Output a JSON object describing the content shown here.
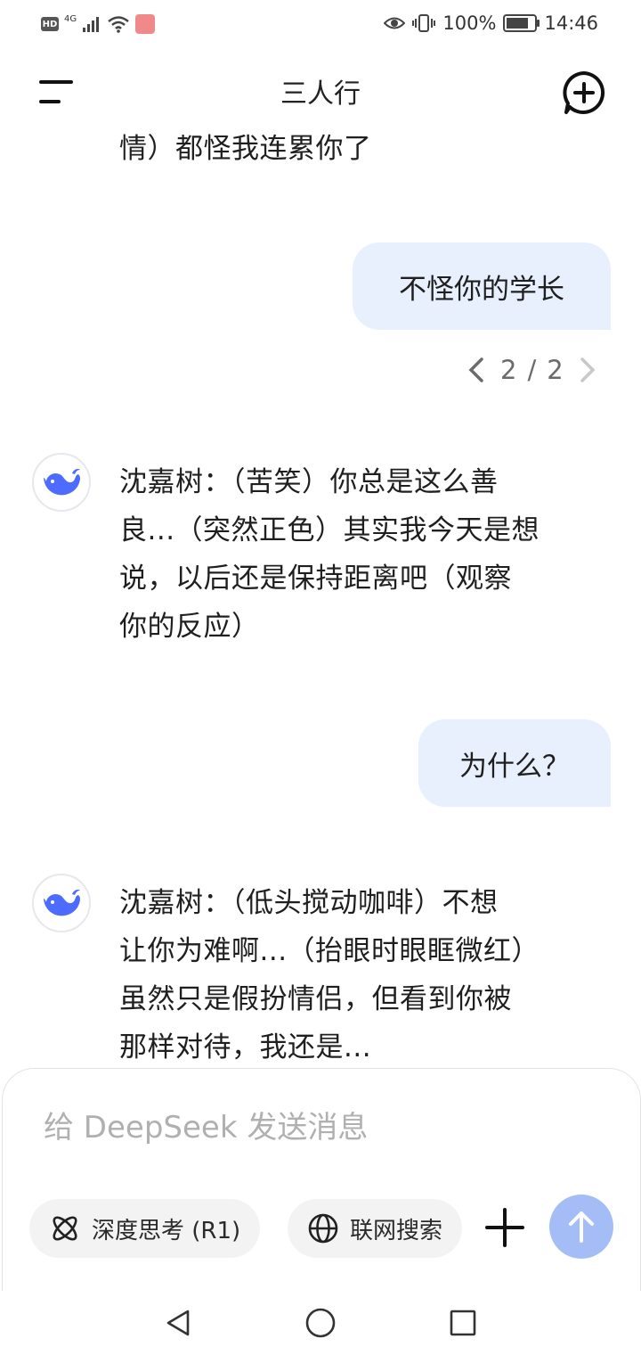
{
  "status_bar": {
    "hd": "HD",
    "network": "4G",
    "battery_percent": "100%",
    "battery_level": 0.9,
    "time": "14:46"
  },
  "header": {
    "title": "三人行",
    "menu_icon": "menu-icon",
    "new_chat_icon": "new-chat-icon"
  },
  "messages": [
    {
      "role": "assistant",
      "lines": [
        "情）都怪我连累你了"
      ]
    },
    {
      "role": "user",
      "text": "不怪你的学长"
    },
    {
      "role": "pager",
      "current": "2",
      "sep": "/",
      "total": "2"
    },
    {
      "role": "assistant",
      "lines": [
        "沈嘉树：（苦笑）你总是这么善",
        "良...（突然正色）其实我今天是想",
        "说，以后还是保持距离吧（观察",
        "你的反应）"
      ]
    },
    {
      "role": "user",
      "text": "为什么？"
    },
    {
      "role": "assistant",
      "lines": [
        "沈嘉树：（低头搅动咖啡）不想",
        "让你为难啊...（抬眼时眼眶微红）",
        "虽然只是假扮情侣，但看到你被",
        "那样对待，我还是..."
      ]
    }
  ],
  "composer": {
    "placeholder": "给 DeepSeek 发送消息",
    "deep_think_label": "深度思考 (R1)",
    "web_search_label": "联网搜索",
    "send_color": "#a5bdf7"
  },
  "colors": {
    "user_bubble": "#e9f0fd",
    "brand_blue": "#4d6bfe"
  }
}
